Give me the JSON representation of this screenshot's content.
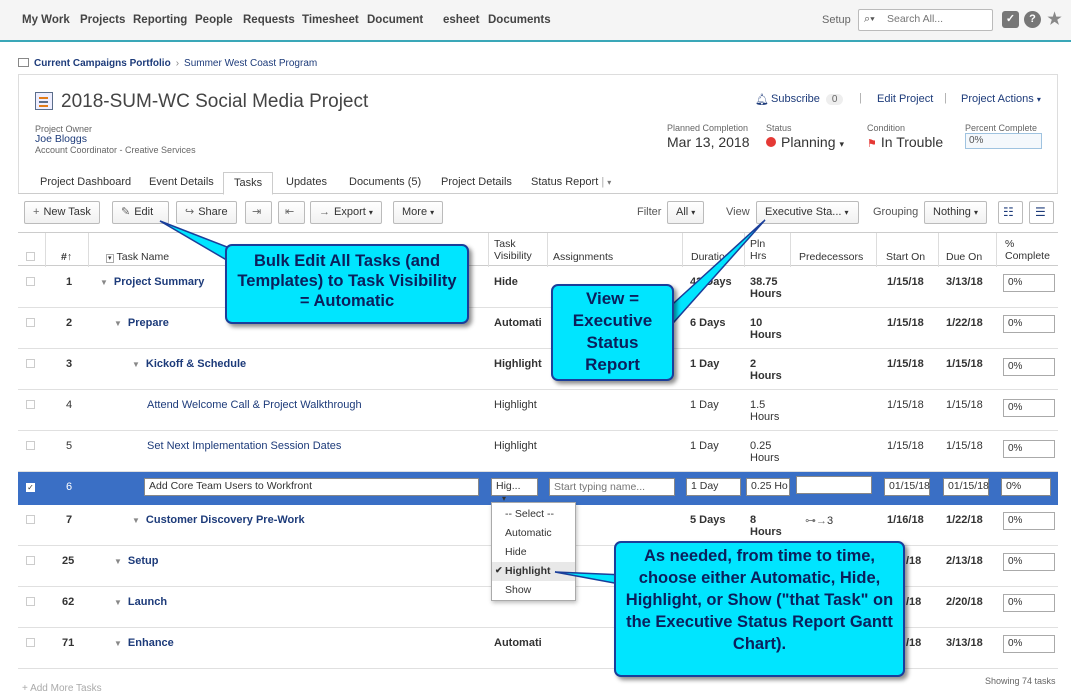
{
  "topnav": {
    "items": [
      "My Work",
      "Projects",
      "Reporting",
      "People",
      "Requests",
      "Timesheet",
      "Document",
      "esheet",
      "Documents"
    ],
    "setup": "Setup",
    "search_placeholder": "Search All...",
    "accent_color": "#3aa7b8"
  },
  "breadcrumb": {
    "parent": "Current Campaigns Portfolio",
    "current": "Summer West Coast Program"
  },
  "project": {
    "title": "2018-SUM-WC Social Media Project",
    "owner_label": "Project Owner",
    "owner_name": "Joe Bloggs",
    "owner_role": "Account Coordinator - Creative Services",
    "planned_label": "Planned Completion",
    "planned_value": "Mar 13, 2018",
    "status_label": "Status",
    "status_value": "Planning",
    "condition_label": "Condition",
    "condition_value": "In Trouble",
    "percent_label": "Percent Complete",
    "percent_value": "0%",
    "subscribe": "Subscribe",
    "subscribe_count": "0",
    "edit_project": "Edit Project",
    "project_actions": "Project Actions"
  },
  "tabs": [
    "Project Dashboard",
    "Event Details",
    "Tasks",
    "Updates",
    "Documents (5)",
    "Project Details",
    "Status Report"
  ],
  "toolbar": {
    "new_task": "New Task",
    "edit": "Edit",
    "share": "Share",
    "export": "Export",
    "more": "More",
    "filter_label": "Filter",
    "filter_value": "All",
    "view_label": "View",
    "view_value": "Executive Sta...",
    "grouping_label": "Grouping",
    "grouping_value": "Nothing"
  },
  "columns": {
    "num": "#",
    "task_name": "Task Name",
    "task_visibility": "Task Visibility",
    "assignments": "Assignments",
    "duration": "Duration",
    "pln_hrs": "Pln Hrs",
    "predecessors": "Predecessors",
    "start_on": "Start On",
    "due_on": "Due On",
    "pct_complete": "% Complete"
  },
  "rows": [
    {
      "num": "1",
      "name": "Project Summary",
      "vis": "Hide",
      "dur": "42 Days",
      "hrs": "38.75 Hours",
      "pred": "",
      "start": "1/15/18",
      "due": "3/13/18",
      "pct": "0%"
    },
    {
      "num": "2",
      "name": "Prepare",
      "vis": "Automati",
      "dur": "6 Days",
      "hrs": "10 Hours",
      "pred": "",
      "start": "1/15/18",
      "due": "1/22/18",
      "pct": "0%"
    },
    {
      "num": "3",
      "name": "Kickoff & Schedule",
      "vis": "Highlight",
      "dur": "1 Day",
      "hrs": "2 Hours",
      "pred": "",
      "start": "1/15/18",
      "due": "1/15/18",
      "pct": "0%"
    },
    {
      "num": "4",
      "name": "Attend Welcome Call & Project Walkthrough",
      "vis": "Highlight",
      "dur": "1 Day",
      "hrs": "1.5 Hours",
      "pred": "",
      "start": "1/15/18",
      "due": "1/15/18",
      "pct": "0%"
    },
    {
      "num": "5",
      "name": "Set Next Implementation Session Dates",
      "vis": "Highlight",
      "dur": "1 Day",
      "hrs": "0.25 Hours",
      "pred": "",
      "start": "1/15/18",
      "due": "1/15/18",
      "pct": "0%"
    },
    {
      "num": "6",
      "name": "Add Core Team Users to Workfront",
      "vis": "Hig...",
      "assign_placeholder": "Start typing name...",
      "dur": "1 Day",
      "hrs": "0.25 Ho",
      "pred": "",
      "start": "01/15/18",
      "due": "01/15/18",
      "pct": "0%"
    },
    {
      "num": "7",
      "name": "Customer Discovery Pre-Work",
      "vis": "",
      "dur": "5 Days",
      "hrs": "8 Hours",
      "pred": "3",
      "start": "1/16/18",
      "due": "1/22/18",
      "pct": "0%"
    },
    {
      "num": "25",
      "name": "Setup",
      "vis": "",
      "dur": "",
      "hrs": "",
      "pred": "",
      "start": "/18",
      "due": "2/13/18",
      "pct": "0%"
    },
    {
      "num": "62",
      "name": "Launch",
      "vis": "",
      "dur": "",
      "hrs": "",
      "pred": "",
      "start": "/18",
      "due": "2/20/18",
      "pct": "0%"
    },
    {
      "num": "71",
      "name": "Enhance",
      "vis": "Automati",
      "dur": "",
      "hrs": "",
      "pred": "",
      "start": "/18",
      "due": "3/13/18",
      "pct": "0%"
    }
  ],
  "dropdown": {
    "options": [
      "-- Select --",
      "Automatic",
      "Hide",
      "Highlight",
      "Show"
    ],
    "selected": "Highlight"
  },
  "callouts": {
    "bulk_edit": "Bulk Edit All Tasks (and Templates) to Task Visibility = Automatic",
    "view": "View = Executive Status Report",
    "as_needed": "As needed, from time to time, choose either Automatic, Hide, Highlight, or Show (\"that Task\" on the Executive Status Report Gantt Chart).",
    "fill_color": "#00e5ff"
  },
  "footer": {
    "add_more": "+ Add More Tasks",
    "showing": "Showing 74 tasks"
  }
}
